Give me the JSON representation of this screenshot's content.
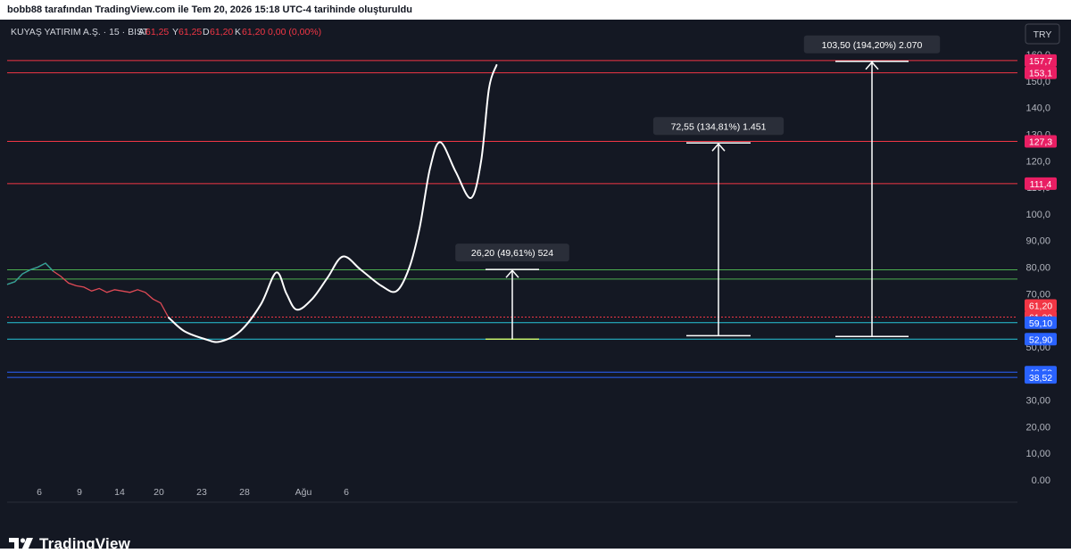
{
  "header": {
    "caption": "bobb88 tarafından TradingView.com ile Tem 20, 2026 15:18 UTC-4 tarihinde oluşturuldu"
  },
  "legend": {
    "symbol": "KUYAŞ YATIRIM A.Ş. · 15 · BIST",
    "open_label": "A",
    "open_value": "61,25",
    "high_label": "Y",
    "high_value": "61,25",
    "low_label": "D",
    "low_value": "61,20",
    "close_label": "K",
    "close_value": "61,20",
    "change": "0,00 (0,00%)"
  },
  "currency_button": "TRY",
  "footer": {
    "brand": "TradingView"
  },
  "colors": {
    "background": "#141823",
    "text": "#d1d4dc",
    "axis_text": "#b2b5be",
    "red_line": "#f23645",
    "green_line": "#4caf50",
    "cyan_line": "#26c6da",
    "blue_line": "#2962ff",
    "pink_badge": "#e91e63",
    "red_badge": "#f23645",
    "blue_badge": "#2962ff"
  },
  "chart_data": {
    "type": "line",
    "y_axis": {
      "ticks": [
        "160,0",
        "150,0",
        "140,0",
        "130,0",
        "120,0",
        "110,0",
        "100,0",
        "90,00",
        "80,00",
        "70,00",
        "60,00",
        "50,00",
        "40,00",
        "30,00",
        "20,00",
        "10,00",
        "0.00"
      ],
      "tick_values": [
        160,
        150,
        140,
        130,
        120,
        110,
        100,
        90,
        80,
        70,
        60,
        50,
        40,
        30,
        20,
        10,
        0
      ],
      "range": [
        0,
        160
      ]
    },
    "x_axis": {
      "ticks": [
        "6",
        "9",
        "14",
        "20",
        "23",
        "28",
        "Ağu",
        "6"
      ]
    },
    "price_series": {
      "name": "KUYAŞ YATIRIM A.Ş.",
      "points": [
        [
          0,
          73.5
        ],
        [
          1,
          74.5
        ],
        [
          2,
          77.5
        ],
        [
          3,
          79
        ],
        [
          4,
          80
        ],
        [
          5,
          81.5
        ],
        [
          6,
          78.5
        ],
        [
          7,
          76.5
        ],
        [
          8,
          74
        ],
        [
          9,
          73
        ],
        [
          10,
          72.5
        ],
        [
          11,
          71
        ],
        [
          12,
          72
        ],
        [
          13,
          70.5
        ],
        [
          14,
          71.5
        ],
        [
          15,
          71
        ],
        [
          16,
          70.5
        ],
        [
          17,
          71.5
        ],
        [
          18,
          70.5
        ],
        [
          19,
          68
        ],
        [
          20,
          66.5
        ],
        [
          21,
          61.2
        ]
      ]
    },
    "projection_path": {
      "points": [
        [
          0,
          61
        ],
        [
          0.6,
          56
        ],
        [
          1.4,
          53
        ],
        [
          2,
          52
        ],
        [
          2.8,
          56
        ],
        [
          3.6,
          66
        ],
        [
          4.2,
          78
        ],
        [
          4.6,
          70
        ],
        [
          5.0,
          64
        ],
        [
          5.6,
          68
        ],
        [
          6.2,
          76
        ],
        [
          6.8,
          84
        ],
        [
          7.5,
          79
        ],
        [
          8.3,
          73
        ],
        [
          8.9,
          71
        ],
        [
          9.4,
          80
        ],
        [
          9.8,
          95
        ],
        [
          10.2,
          117
        ],
        [
          10.6,
          127
        ],
        [
          11.2,
          116
        ],
        [
          11.8,
          106
        ],
        [
          12.2,
          120
        ],
        [
          12.5,
          147
        ],
        [
          12.8,
          156
        ]
      ]
    },
    "horizontal_levels": [
      {
        "value": 157.7,
        "label": "157,7",
        "style": "pink"
      },
      {
        "value": 153.1,
        "label": "153,1",
        "style": "pink"
      },
      {
        "value": 127.3,
        "label": "127,3",
        "style": "pink"
      },
      {
        "value": 111.4,
        "label": "111,4",
        "style": "pink"
      },
      {
        "value": 79.0,
        "label": "",
        "style": "green"
      },
      {
        "value": 75.5,
        "label": "",
        "style": "green"
      },
      {
        "value": 61.2,
        "label": "61,20",
        "style": "red"
      },
      {
        "value": 59.1,
        "label": "59,10",
        "style": "blue"
      },
      {
        "value": 52.9,
        "label": "52,90",
        "style": "blue"
      },
      {
        "value": 40.5,
        "label": "40,50",
        "style": "blue"
      },
      {
        "value": 38.52,
        "label": "38,52",
        "style": "blue"
      }
    ],
    "last_price": {
      "value": 61.2,
      "label": "61,20"
    },
    "measurements": [
      {
        "label": "26,20 (49,61%) 524",
        "from": 52.9,
        "to": 79.1
      },
      {
        "label": "72,55 (134,81%) 1.451",
        "from": 54.2,
        "to": 126.7
      },
      {
        "label": "103,50 (194,20%) 2.070",
        "from": 53.9,
        "to": 157.4
      }
    ]
  }
}
